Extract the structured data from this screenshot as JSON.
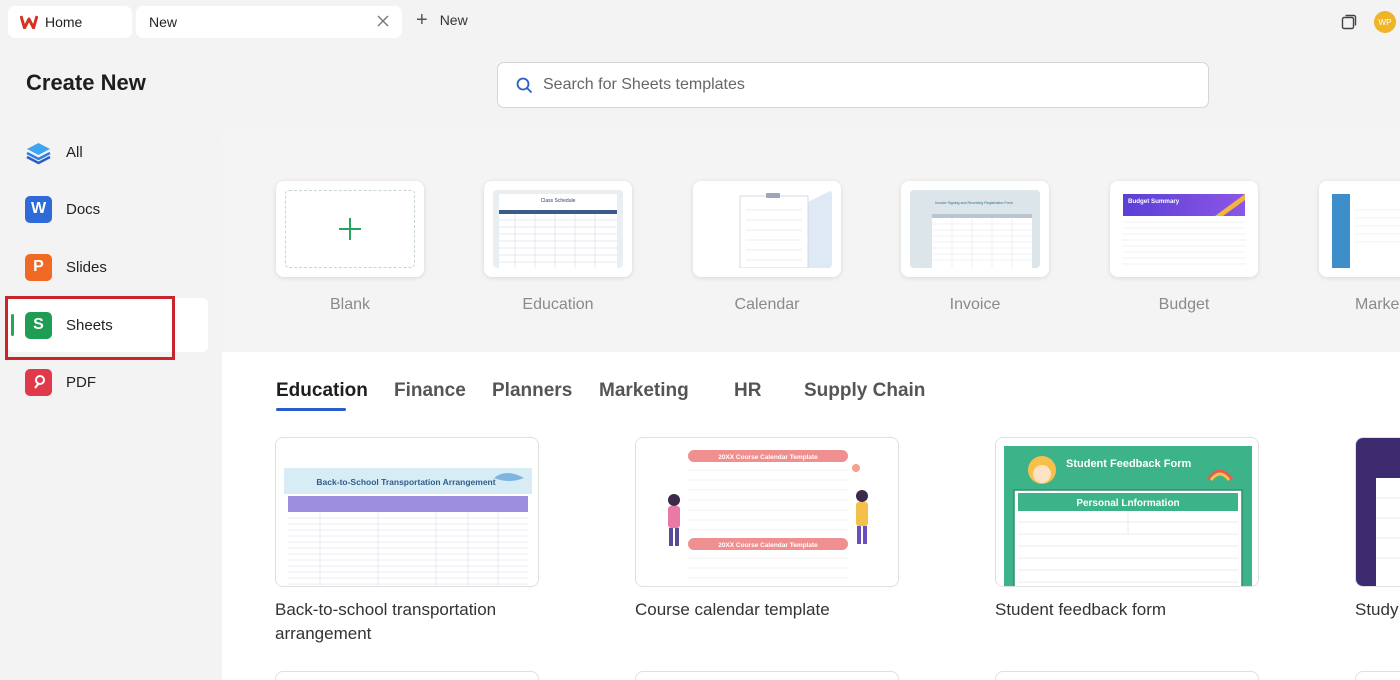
{
  "tabs": {
    "home_label": "Home",
    "new_label": "New",
    "new_tab_label": "New"
  },
  "avatar_initials": "WP",
  "page_title": "Create New",
  "sidebar": {
    "items": [
      {
        "label": "All",
        "icon": "layers-icon"
      },
      {
        "label": "Docs",
        "icon_letter": "W"
      },
      {
        "label": "Slides",
        "icon_letter": "P"
      },
      {
        "label": "Sheets",
        "icon_letter": "S"
      },
      {
        "label": "PDF",
        "icon": "pdf-icon"
      }
    ]
  },
  "search": {
    "placeholder": "Search for Sheets templates"
  },
  "quick_templates": [
    {
      "label": "Blank"
    },
    {
      "label": "Education",
      "thumb_title": "Class Schedule"
    },
    {
      "label": "Calendar"
    },
    {
      "label": "Invoice",
      "thumb_title": "Invoice Signing and Receiving Registration Form"
    },
    {
      "label": "Budget",
      "thumb_title": "Budget Summary"
    },
    {
      "label": "Marke"
    }
  ],
  "categories": [
    "Education",
    "Finance",
    "Planners",
    "Marketing",
    "HR",
    "Supply Chain"
  ],
  "templates": [
    {
      "title_line1": "Back-to-school transportation",
      "title_line2": "arrangement",
      "thumb_title": "Back-to-School Transportation Arrangement"
    },
    {
      "title_line1": "Course calendar template",
      "title_line2": "",
      "thumb_title": "20XX Course Calendar Template"
    },
    {
      "title_line1": "Student feedback form",
      "title_line2": "",
      "thumb_title": "Student Feedback Form",
      "thumb_subtitle": "Personal Lnformation"
    },
    {
      "title_line1": "Study",
      "title_line2": ""
    }
  ],
  "colors": {
    "sheets_green": "#1f9d55",
    "docs_blue": "#2f6bd8",
    "slides_orange": "#f06a23",
    "pdf_red": "#e0394a",
    "accent_blue": "#2a5dc9",
    "highlight_red": "#c9262c"
  }
}
